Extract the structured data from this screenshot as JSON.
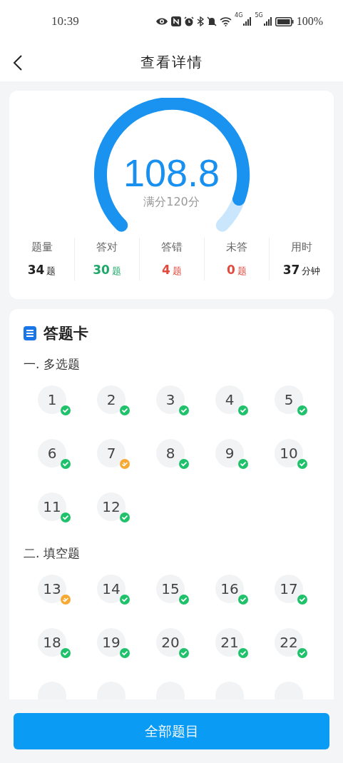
{
  "status_bar": {
    "time": "10:39",
    "network_1": "4G",
    "network_2": "5G",
    "battery": "100%"
  },
  "header": {
    "title": "查看详情"
  },
  "score": {
    "value": "108.8",
    "caption": "满分120分"
  },
  "stats": [
    {
      "label": "题量",
      "value": "34",
      "unit": "题",
      "color": "#222222"
    },
    {
      "label": "答对",
      "value": "30",
      "unit": "题",
      "color": "#20a86a"
    },
    {
      "label": "答错",
      "value": "4",
      "unit": "题",
      "color": "#e04a3f"
    },
    {
      "label": "未答",
      "value": "0",
      "unit": "题",
      "color": "#e04a3f"
    },
    {
      "label": "用时",
      "value": "37",
      "unit": "分钟",
      "color": "#222222"
    }
  ],
  "answer_card": {
    "title": "答题卡",
    "sections": [
      {
        "title": "一. 多选题",
        "items": [
          {
            "number": "1",
            "kind": "correct"
          },
          {
            "number": "2",
            "kind": "correct"
          },
          {
            "number": "3",
            "kind": "correct"
          },
          {
            "number": "4",
            "kind": "correct"
          },
          {
            "number": "5",
            "kind": "correct"
          },
          {
            "number": "6",
            "kind": "correct"
          },
          {
            "number": "7",
            "kind": "partial"
          },
          {
            "number": "8",
            "kind": "correct"
          },
          {
            "number": "9",
            "kind": "correct"
          },
          {
            "number": "10",
            "kind": "correct"
          },
          {
            "number": "11",
            "kind": "correct"
          },
          {
            "number": "12",
            "kind": "correct"
          }
        ]
      },
      {
        "title": "二. 填空题",
        "items": [
          {
            "number": "13",
            "kind": "partial"
          },
          {
            "number": "14",
            "kind": "correct"
          },
          {
            "number": "15",
            "kind": "correct"
          },
          {
            "number": "16",
            "kind": "correct"
          },
          {
            "number": "17",
            "kind": "correct"
          },
          {
            "number": "18",
            "kind": "correct"
          },
          {
            "number": "19",
            "kind": "correct"
          },
          {
            "number": "20",
            "kind": "correct"
          },
          {
            "number": "21",
            "kind": "correct"
          },
          {
            "number": "22",
            "kind": "correct"
          },
          {
            "kind": "cut"
          },
          {
            "kind": "cut"
          },
          {
            "kind": "cut"
          },
          {
            "kind": "cut"
          },
          {
            "kind": "cut"
          }
        ]
      }
    ]
  },
  "footer": {
    "button": "全部题目"
  }
}
